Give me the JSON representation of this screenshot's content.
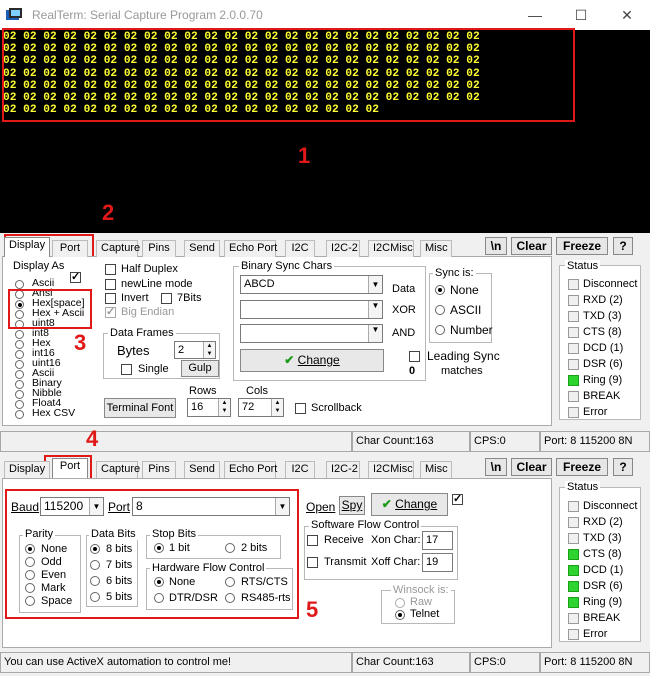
{
  "window": {
    "title": "RealTerm: Serial Capture Program 2.0.0.70",
    "min": "—",
    "max": "☐",
    "close": "✕"
  },
  "terminal": {
    "lines": [
      "02 02 02 02 02 02 02 02 02 02 02 02 02 02 02 02 02 02 02 02 02 02 02 02",
      "02 02 02 02 02 02 02 02 02 02 02 02 02 02 02 02 02 02 02 02 02 02 02 02",
      "02 02 02 02 02 02 02 02 02 02 02 02 02 02 02 02 02 02 02 02 02 02 02 02",
      "02 02 02 02 02 02 02 02 02 02 02 02 02 02 02 02 02 02 02 02 02 02 02 02",
      "02 02 02 02 02 02 02 02 02 02 02 02 02 02 02 02 02 02 02 02 02 02 02 02",
      "02 02 02 02 02 02 02 02 02 02 02 02 02 02 02 02 02 02 02 02 02 02 02 02",
      "02 02 02 02 02 02 02 02 02 02 02 02 02 02 02 02 02 02 02"
    ]
  },
  "annotations": {
    "n1": "1",
    "n2": "2",
    "n3": "3",
    "n4": "4",
    "n5": "5"
  },
  "tabs": [
    "Display",
    "Port",
    "Capture",
    "Pins",
    "Send",
    "Echo Port",
    "I2C",
    "I2C-2",
    "I2CMisc",
    "Misc"
  ],
  "toolbar": {
    "newline": "\\n",
    "clear": "Clear",
    "freeze": "Freeze",
    "help": "?"
  },
  "display": {
    "display_as_label": "Display As",
    "formats": [
      "Ascii",
      "Ansi",
      "Hex[space]",
      "Hex + Ascii",
      "uint8",
      "int8",
      "Hex",
      "int16",
      "uint16",
      "Ascii",
      "Binary",
      "Nibble",
      "Float4",
      "Hex CSV"
    ],
    "selected_format": "Hex[space]",
    "half_duplex": "Half Duplex",
    "newline_mode": "newLine mode",
    "invert": "Invert",
    "seven_bits": "7Bits",
    "big_endian": "Big Endian",
    "data_frames_label": "Data Frames",
    "bytes_label": "Bytes",
    "bytes_value": "2",
    "single_label": "Single",
    "gulp_label": "Gulp",
    "terminal_font": "Terminal Font",
    "rows_label": "Rows",
    "rows_value": "16",
    "cols_label": "Cols",
    "cols_value": "72",
    "scrollback": "Scrollback",
    "binary_sync_label": "Binary Sync Chars",
    "sync_value": "ABCD",
    "data_label": "Data",
    "xor_label": "XOR",
    "and_label": "AND",
    "change": "Change",
    "sync_is_label": "Sync is:",
    "sync_none": "None",
    "sync_ascii": "ASCII",
    "sync_number": "Number",
    "leading_sync": "Leading Sync",
    "matches_count": "0",
    "matches": "matches"
  },
  "status": {
    "label": "Status",
    "items": [
      {
        "name": "Disconnect",
        "on1": false,
        "on2": false
      },
      {
        "name": "RXD (2)",
        "on1": false,
        "on2": false
      },
      {
        "name": "TXD (3)",
        "on1": false,
        "on2": false
      },
      {
        "name": "CTS (8)",
        "on1": false,
        "on2": true
      },
      {
        "name": "DCD (1)",
        "on1": false,
        "on2": true
      },
      {
        "name": "DSR (6)",
        "on1": false,
        "on2": true
      },
      {
        "name": "Ring (9)",
        "on1": true,
        "on2": true
      },
      {
        "name": "BREAK",
        "on1": false,
        "on2": false
      },
      {
        "name": "Error",
        "on1": false,
        "on2": false
      }
    ]
  },
  "statusbar1": {
    "msg": "",
    "char_count": "Char Count:163",
    "cps": "CPS:0",
    "port": "Port: 8 115200 8N"
  },
  "port": {
    "baud_label": "Baud",
    "baud_value": "115200",
    "port_label": "Port",
    "port_value": "8",
    "open": "Open",
    "spy": "Spy",
    "change": "Change",
    "parity_label": "Parity",
    "parity": [
      "None",
      "Odd",
      "Even",
      "Mark",
      "Space"
    ],
    "databits_label": "Data Bits",
    "databits": [
      "8 bits",
      "7 bits",
      "6 bits",
      "5 bits"
    ],
    "stopbits_label": "Stop Bits",
    "stop1": "1 bit",
    "stop2": "2 bits",
    "hwflow_label": "Hardware Flow Control",
    "hw_none": "None",
    "hw_rtscts": "RTS/CTS",
    "hw_dtrdsr": "DTR/DSR",
    "hw_rs485": "RS485-rts",
    "swflow_label": "Software Flow Control",
    "receive": "Receive",
    "xon_label": "Xon Char:",
    "xon_value": "17",
    "transmit": "Transmit",
    "xoff_label": "Xoff Char:",
    "xoff_value": "19",
    "winsock_label": "Winsock is:",
    "raw": "Raw",
    "telnet": "Telnet"
  },
  "statusbar2": {
    "msg": "You can use ActiveX automation to control me!",
    "char_count": "Char Count:163",
    "cps": "CPS:0",
    "port": "Port: 8 115200 8N"
  },
  "colors": {
    "term_text": "#ffff33",
    "annotation": "#e01818",
    "led_on": "#2ed42e"
  }
}
